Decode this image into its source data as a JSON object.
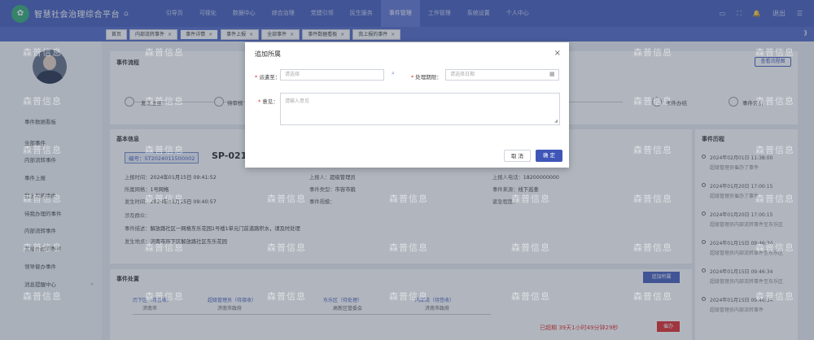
{
  "app": {
    "title": "智慧社会治理综合平台"
  },
  "nav": [
    "引导页",
    "可视化",
    "数据中心",
    "综合治理",
    "党建引领",
    "民生服务",
    "事件管理",
    "工作管理",
    "系统设置",
    "个人中心"
  ],
  "nav_active": 6,
  "top_right": {
    "user": "退出"
  },
  "tabs": [
    {
      "label": "首页"
    },
    {
      "label": "内部流转事件"
    },
    {
      "label": "事件详情"
    },
    {
      "label": "事件上报"
    },
    {
      "label": "全部事件"
    },
    {
      "label": "事件数据看板"
    },
    {
      "label": "我上报的事件"
    }
  ],
  "sidebar": {
    "items": [
      "事件数据看板",
      "全部事件",
      "内部流转事件",
      "事件上报",
      "我上报的事件",
      "待我办理的事件",
      "内部流转事件",
      "我经办过的事件",
      "领导督办事件",
      "消息提醒中心"
    ]
  },
  "main": {
    "flow_title": "事件流程",
    "flow_button": "查看流程图",
    "steps": [
      "发现上报",
      "待审核",
      "事件办结",
      "事件评价"
    ],
    "basic_title": "基本信息",
    "badge": "编号：ST2024011500002",
    "case_no": "SP-021",
    "fields": [
      {
        "label": "上报时间：",
        "value": "2024年01月15日 09:41:52"
      },
      {
        "label": "上报人：",
        "value": "超级管理员"
      },
      {
        "label": "上报人电话：",
        "value": "18200000000"
      },
      {
        "label": "所属网格：",
        "value": "1号网格"
      },
      {
        "label": "事件类型：",
        "value": "市容市貌"
      },
      {
        "label": "事件来源：",
        "value": "线下巡查"
      },
      {
        "label": "发生时间：",
        "value": "2024年01月15日 09:40:57"
      },
      {
        "label": "事件规模：",
        "value": ""
      },
      {
        "label": "紧急程度：",
        "value": ""
      },
      {
        "label": "涉及群众：",
        "value": ""
      },
      {
        "label": "事件描述：",
        "value": "解放路社区一网格东乐花园1号楼1单元门前道路积水，请及时处理"
      },
      {
        "label": "发生地点：",
        "value": "济南市历下区解放路社区东乐花园"
      }
    ],
    "handle_title": "事件处置",
    "handle_button": "追加所属",
    "handle_flow": [
      {
        "name": "历下区（待签收）",
        "org": "济南市"
      },
      {
        "name": "超级管理员（待接收）",
        "org": "济南市政府"
      },
      {
        "name": "东乐区（待处理）",
        "org": "高新区管委会"
      },
      {
        "name": "内部流（待签收）",
        "org": "济南市政府"
      }
    ],
    "timer": "已超期 39天1小时49分钟29秒",
    "timer_btn": "催办",
    "process_title": "事件历程",
    "process": [
      {
        "time": "2024年02月01日 11:38:00",
        "text": "超级管理员催办了事件"
      },
      {
        "time": "2024年01月20日 17:00:15",
        "text": "超级管理员催办了事件"
      },
      {
        "time": "2024年01月20日 17:00:15",
        "text": "超级管理员内部流转事件至东乐区"
      },
      {
        "time": "2024年01月15日 09:46:34",
        "text": "超级管理员内部流转事件至东乐区"
      },
      {
        "time": "2024年01月15日 09:46:34",
        "text": "超级管理员内部流转事件至东乐区"
      },
      {
        "time": "2024年01月15日 09:46:34",
        "text": "超级管理员内部流转事件"
      }
    ]
  },
  "watermark": "森普信息",
  "dialog": {
    "title": "追加所属",
    "assignee_label": "派遣至：",
    "assignee_placeholder": "请选择",
    "deadline_label": "处理期限：",
    "deadline_placeholder": "请选择日期",
    "opinion_label": "意见：",
    "opinion_placeholder": "请输入意见",
    "cancel": "取 消",
    "confirm": "确 定"
  },
  "colors": {
    "primary": "#3f56b8",
    "danger": "#e02424",
    "logo": "#2aa870"
  }
}
